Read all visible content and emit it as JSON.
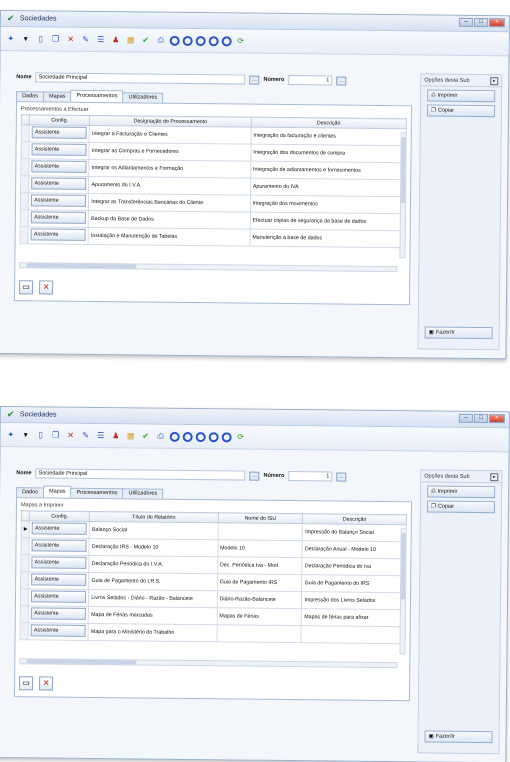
{
  "colors": {
    "accent": "#2a54c8",
    "delete": "#c8261c",
    "titlebar": "#d6e2f3"
  },
  "window1": {
    "title": "Sociedades",
    "name_label": "Nome",
    "name_value": "Sociedade Principal",
    "number_label": "Número",
    "number_value": "1",
    "tabs": [
      {
        "label": "Dados",
        "active": false
      },
      {
        "label": "Mapas",
        "active": false
      },
      {
        "label": "Processamentos",
        "active": true
      },
      {
        "label": "Utilizadores",
        "active": false
      }
    ],
    "panel_caption": "Processamentos a Efectuar",
    "columns": [
      "Config.",
      "Designação do Processamento",
      "Descrição"
    ],
    "rows": [
      {
        "config": "Assistente",
        "designacao": "Integrar a Facturação e Clientes",
        "descricao": "Integração da facturação e clientes"
      },
      {
        "config": "Assistente",
        "designacao": "Integrar as Compras e Fornecedores",
        "descricao": "Integração dos documentos de compra"
      },
      {
        "config": "Assistente",
        "designacao": "Integrar os Adiantamentos e Formação",
        "descricao": "Integração de adiantamentos e fornecimentos"
      },
      {
        "config": "Assistente",
        "designacao": "Apuramento do I.V.A.",
        "descricao": "Apuramento do IVA"
      },
      {
        "config": "Assistente",
        "designacao": "Integrar as Transferências Bancárias do Cliente",
        "descricao": "Integração dos movimentos"
      },
      {
        "config": "Assistente",
        "designacao": "Backup da Base de Dados",
        "descricao": "Efectuar cópias de segurança da base de dados"
      },
      {
        "config": "Assistente",
        "designacao": "Instalação e Manutenção de Tabelas",
        "descricao": "Manutenção à base de dados"
      }
    ],
    "side_header": "Opções desta Sub",
    "side_buttons": [
      "Imprimir",
      "Copiar"
    ],
    "side_bottom": "Fazer/Ir"
  },
  "window2": {
    "title": "Sociedades",
    "name_label": "Nome",
    "name_value": "Sociedade Principal",
    "number_label": "Número",
    "number_value": "1",
    "tabs": [
      {
        "label": "Dados",
        "active": false
      },
      {
        "label": "Mapas",
        "active": true
      },
      {
        "label": "Processamentos",
        "active": false
      },
      {
        "label": "Utilizadores",
        "active": false
      }
    ],
    "panel_caption": "Mapas a Imprimir",
    "columns": [
      "Config.",
      "Título do Relatório",
      "Nome do ISU",
      "Descrição"
    ],
    "rows": [
      {
        "config": "Assistente",
        "titulo": "Balanço Social",
        "nome": "",
        "descricao": "Impressão do Balanço Social"
      },
      {
        "config": "Assistente",
        "titulo": "Declaração IRS - Modelo 10",
        "nome": "Modelo 10",
        "descricao": "Declaração Anual - Modelo 10"
      },
      {
        "config": "Assistente",
        "titulo": "Declaração Periódica do I.V.A.",
        "nome": "Dec. Periódica Iva - Mod",
        "descricao": "Declaração Periódica do Iva"
      },
      {
        "config": "Assistente",
        "titulo": "Guia de Pagamento do I.R.S.",
        "nome": "Guia de Pagamento IRS",
        "descricao": "Guia de Pagamento do IRS"
      },
      {
        "config": "Assistente",
        "titulo": "Livros Selados - Diário - Razão - Balancete",
        "nome": "Diário-Razão-Balancete",
        "descricao": "Impressão dos Livros Selados"
      },
      {
        "config": "Assistente",
        "titulo": "Mapa de Férias marcadas",
        "nome": "Mapas de Férias",
        "descricao": "Mapas de férias para afixar"
      },
      {
        "config": "Assistente",
        "titulo": "Mapa para o Ministério do Trabalho",
        "nome": "",
        "descricao": ""
      }
    ],
    "side_header": "Opções desta Sub",
    "side_buttons": [
      "Imprimir",
      "Copiar"
    ],
    "side_bottom": "Fazer/Ir"
  },
  "icons": {
    "toolbar": [
      "new-icon",
      "dropdown-icon",
      "document-icon",
      "open-icon",
      "delete-icon",
      "edit-icon",
      "list-icon",
      "users-icon",
      "chart-icon",
      "check-icon",
      "print-icon",
      "circle-icon",
      "circle-icon",
      "circle-icon",
      "circle-icon",
      "circle-icon",
      "refresh-icon"
    ]
  }
}
